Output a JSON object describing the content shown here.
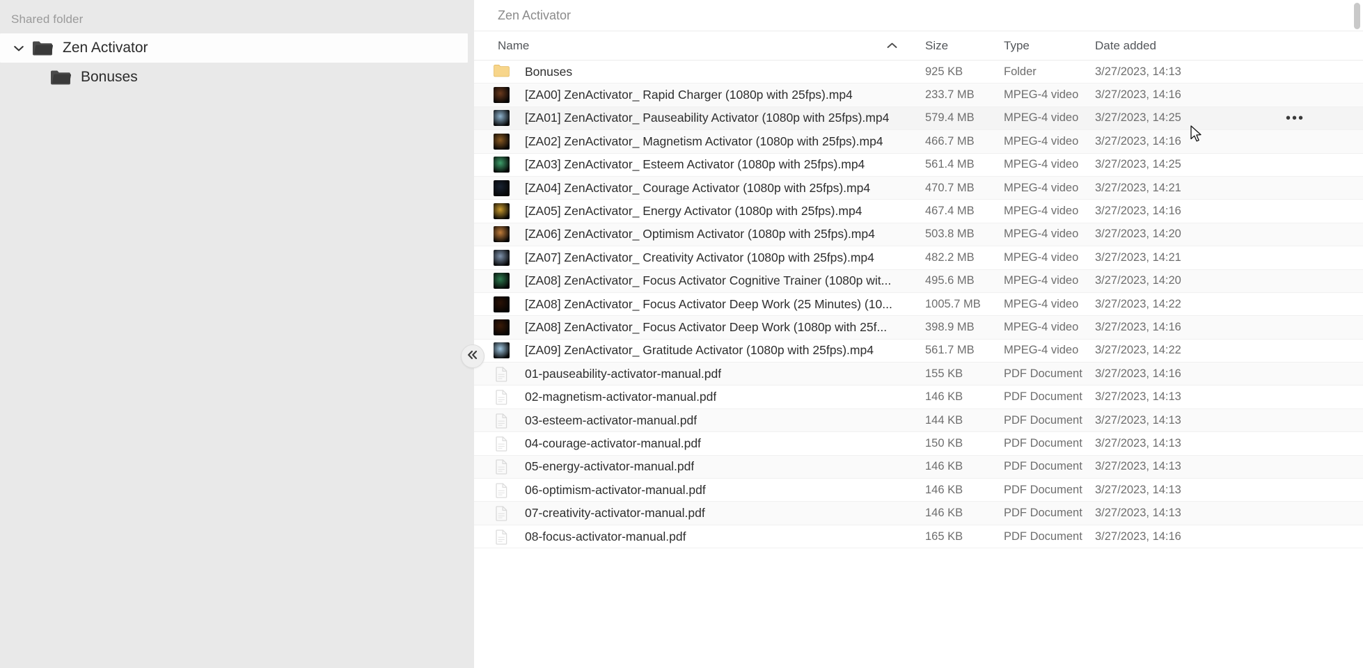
{
  "sidebar": {
    "title": "Shared folder",
    "collapse_button_label": "«",
    "items": [
      {
        "label": "Zen Activator",
        "icon": "folder-icon",
        "caret": "chevron-down-icon",
        "selected": true,
        "depth": 0
      },
      {
        "label": "Bonuses",
        "icon": "folder-icon",
        "caret": "",
        "selected": false,
        "depth": 1
      }
    ]
  },
  "breadcrumb": {
    "current": "Zen Activator"
  },
  "table": {
    "columns": {
      "name": "Name",
      "size": "Size",
      "type": "Type",
      "date": "Date added",
      "sort_icon": "chevron-up-icon",
      "more_icon": "ellipsis-icon"
    },
    "sort": {
      "column": "Name",
      "direction": "asc"
    },
    "rows": [
      {
        "name": "Bonuses",
        "size": "925 KB",
        "type": "Folder",
        "date": "3/27/2023, 14:13",
        "kind": "folder",
        "thumb": "#f6c76a",
        "hovered": false
      },
      {
        "name": "[ZA00] ZenActivator_ Rapid Charger (1080p with 25fps).mp4",
        "size": "233.7 MB",
        "type": "MPEG-4 video",
        "date": "3/27/2023, 14:16",
        "kind": "video",
        "thumb": "#6b3a1d",
        "hovered": false
      },
      {
        "name": "[ZA01] ZenActivator_ Pauseability Activator (1080p with 25fps).mp4",
        "size": "579.4 MB",
        "type": "MPEG-4 video",
        "date": "3/27/2023, 14:25",
        "kind": "video",
        "thumb": "#8fb4cf",
        "hovered": true
      },
      {
        "name": "[ZA02] ZenActivator_ Magnetism Activator (1080p with 25fps).mp4",
        "size": "466.7 MB",
        "type": "MPEG-4 video",
        "date": "3/27/2023, 14:16",
        "kind": "video",
        "thumb": "#8a5a23",
        "hovered": false
      },
      {
        "name": "[ZA03] ZenActivator_ Esteem Activator (1080p with 25fps).mp4",
        "size": "561.4 MB",
        "type": "MPEG-4 video",
        "date": "3/27/2023, 14:25",
        "kind": "video",
        "thumb": "#3e9e6a",
        "hovered": false
      },
      {
        "name": "[ZA04] ZenActivator_ Courage Activator (1080p with 25fps).mp4",
        "size": "470.7 MB",
        "type": "MPEG-4 video",
        "date": "3/27/2023, 14:21",
        "kind": "video",
        "thumb": "#182231",
        "hovered": false
      },
      {
        "name": "[ZA05] ZenActivator_ Energy Activator (1080p with 25fps).mp4",
        "size": "467.4 MB",
        "type": "MPEG-4 video",
        "date": "3/27/2023, 14:16",
        "kind": "video",
        "thumb": "#c99a2e",
        "hovered": false
      },
      {
        "name": "[ZA06] ZenActivator_ Optimism Activator (1080p with 25fps).mp4",
        "size": "503.8 MB",
        "type": "MPEG-4 video",
        "date": "3/27/2023, 14:20",
        "kind": "video",
        "thumb": "#c07c3a",
        "hovered": false
      },
      {
        "name": "[ZA07] ZenActivator_ Creativity Activator (1080p with 25fps).mp4",
        "size": "482.2 MB",
        "type": "MPEG-4 video",
        "date": "3/27/2023, 14:21",
        "kind": "video",
        "thumb": "#7f93ad",
        "hovered": false
      },
      {
        "name": "[ZA08] ZenActivator_ Focus Activator Cognitive Trainer (1080p wit...",
        "size": "495.6 MB",
        "type": "MPEG-4 video",
        "date": "3/27/2023, 14:20",
        "kind": "video",
        "thumb": "#2d7a4e",
        "hovered": false
      },
      {
        "name": "[ZA08] ZenActivator_ Focus Activator Deep Work (25 Minutes) (10...",
        "size": "1005.7 MB",
        "type": "MPEG-4 video",
        "date": "3/27/2023, 14:22",
        "kind": "video",
        "thumb": "#2a1206",
        "hovered": false
      },
      {
        "name": "[ZA08] ZenActivator_ Focus Activator Deep Work (1080p with 25f...",
        "size": "398.9 MB",
        "type": "MPEG-4 video",
        "date": "3/27/2023, 14:16",
        "kind": "video",
        "thumb": "#3a1a08",
        "hovered": false
      },
      {
        "name": "[ZA09] ZenActivator_ Gratitude Activator (1080p with 25fps).mp4",
        "size": "561.7 MB",
        "type": "MPEG-4 video",
        "date": "3/27/2023, 14:22",
        "kind": "video",
        "thumb": "#9fc6e0",
        "hovered": false
      },
      {
        "name": "01-pauseability-activator-manual.pdf",
        "size": "155 KB",
        "type": "PDF Document",
        "date": "3/27/2023, 14:16",
        "kind": "pdf",
        "thumb": "",
        "hovered": false
      },
      {
        "name": "02-magnetism-activator-manual.pdf",
        "size": "146 KB",
        "type": "PDF Document",
        "date": "3/27/2023, 14:13",
        "kind": "pdf",
        "thumb": "",
        "hovered": false
      },
      {
        "name": "03-esteem-activator-manual.pdf",
        "size": "144 KB",
        "type": "PDF Document",
        "date": "3/27/2023, 14:13",
        "kind": "pdf",
        "thumb": "",
        "hovered": false
      },
      {
        "name": "04-courage-activator-manual.pdf",
        "size": "150 KB",
        "type": "PDF Document",
        "date": "3/27/2023, 14:13",
        "kind": "pdf",
        "thumb": "",
        "hovered": false
      },
      {
        "name": "05-energy-activator-manual.pdf",
        "size": "146 KB",
        "type": "PDF Document",
        "date": "3/27/2023, 14:13",
        "kind": "pdf",
        "thumb": "",
        "hovered": false
      },
      {
        "name": "06-optimism-activator-manual.pdf",
        "size": "146 KB",
        "type": "PDF Document",
        "date": "3/27/2023, 14:13",
        "kind": "pdf",
        "thumb": "",
        "hovered": false
      },
      {
        "name": "07-creativity-activator-manual.pdf",
        "size": "146 KB",
        "type": "PDF Document",
        "date": "3/27/2023, 14:13",
        "kind": "pdf",
        "thumb": "",
        "hovered": false
      },
      {
        "name": "08-focus-activator-manual.pdf",
        "size": "165 KB",
        "type": "PDF Document",
        "date": "3/27/2023, 14:16",
        "kind": "pdf",
        "thumb": "",
        "hovered": false
      }
    ]
  },
  "colors": {
    "sidebar_bg": "#e9e9e9",
    "selected_bg": "#fdfdfd",
    "row_alt_bg": "#fafafa",
    "hover_bg": "#f4f4f4",
    "text": "#2e2e2e",
    "muted": "#6e6e6e"
  }
}
